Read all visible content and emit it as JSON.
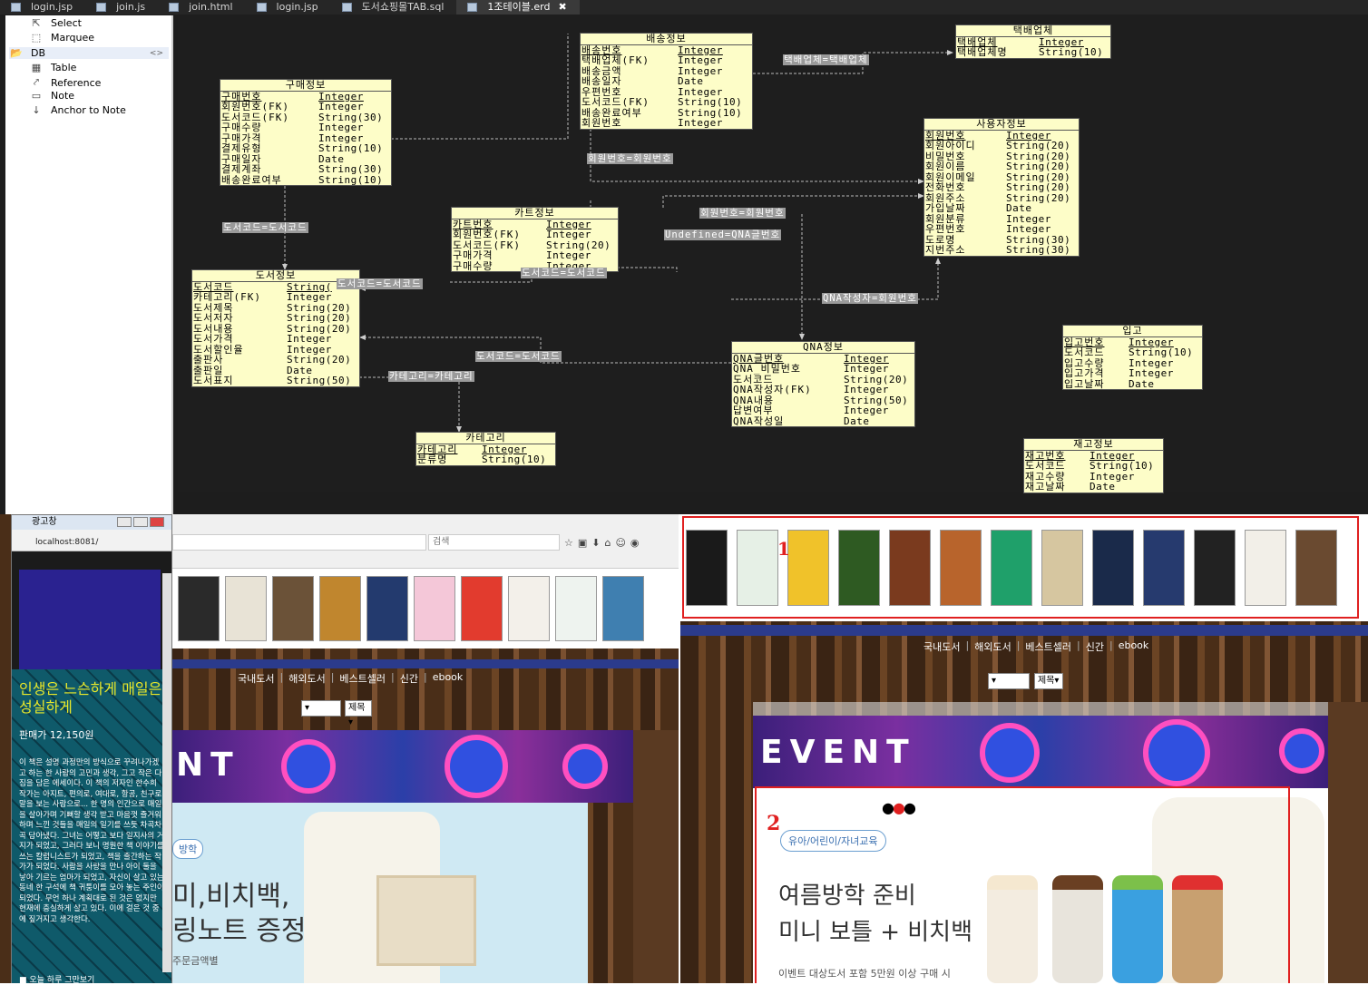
{
  "tabs": [
    {
      "label": "login.jsp"
    },
    {
      "label": "join.js"
    },
    {
      "label": "join.html"
    },
    {
      "label": "login.jsp"
    },
    {
      "label": "도서쇼핑몰TAB.sql"
    },
    {
      "label": "1조테이블.erd",
      "active": true
    }
  ],
  "palette": {
    "select": "Select",
    "marquee": "Marquee",
    "db": "DB",
    "table": "Table",
    "reference": "Reference",
    "note": "Note",
    "anchor": "Anchor to Note"
  },
  "entities": {
    "delivery_company": {
      "title": "택배업체",
      "rows": [
        [
          "택배업체",
          "Integer"
        ],
        [
          "택배업체명",
          "String(10)"
        ]
      ]
    },
    "shipping": {
      "title": "배송정보",
      "rows": [
        [
          "배송번호",
          "Integer"
        ],
        [
          "택배업체(FK)",
          "Integer"
        ],
        [
          "배송금액",
          "Integer"
        ],
        [
          "배송일자",
          "Date"
        ],
        [
          "우편번호",
          "Integer"
        ],
        [
          "도서코드(FK)",
          "String(10)"
        ],
        [
          "배송완료여부",
          "String(10)"
        ],
        [
          "회원번호",
          "Integer"
        ]
      ]
    },
    "purchase": {
      "title": "구매정보",
      "rows": [
        [
          "구매번호",
          "Integer"
        ],
        [
          "회원번호(FK)",
          "Integer"
        ],
        [
          "도서코드(FK)",
          "String(30)"
        ],
        [
          "구매수량",
          "Integer"
        ],
        [
          "구매가격",
          "Integer"
        ],
        [
          "결제유형",
          "String(10)"
        ],
        [
          "구매일자",
          "Date"
        ],
        [
          "결제계좌",
          "String(30)"
        ],
        [
          "배송완료여부",
          "String(10)"
        ]
      ]
    },
    "user": {
      "title": "사용자정보",
      "rows": [
        [
          "회원번호",
          "Integer"
        ],
        [
          "회원아이디",
          "String(20)"
        ],
        [
          "비밀번호",
          "String(20)"
        ],
        [
          "회원이름",
          "String(20)"
        ],
        [
          "회원이메일",
          "String(20)"
        ],
        [
          "전화번호",
          "String(20)"
        ],
        [
          "회원주소",
          "String(20)"
        ],
        [
          "가입날짜",
          "Date"
        ],
        [
          "회원분류",
          "Integer"
        ],
        [
          "우편번호",
          "Integer"
        ],
        [
          "도로명",
          "String(30)"
        ],
        [
          "지번주소",
          "String(30)"
        ]
      ]
    },
    "cart": {
      "title": "카트정보",
      "rows": [
        [
          "카트번호",
          "Integer"
        ],
        [
          "회원번호(FK)",
          "Integer"
        ],
        [
          "도서코드(FK)",
          "String(20)"
        ],
        [
          "구매가격",
          "Integer"
        ],
        [
          "구매수량",
          "Integer"
        ]
      ]
    },
    "book": {
      "title": "도서정보",
      "rows": [
        [
          "도서코드",
          "String("
        ],
        [
          "카테고리(FK)",
          "Integer"
        ],
        [
          "도서제목",
          "String(20)"
        ],
        [
          "도서저자",
          "String(20)"
        ],
        [
          "도서내용",
          "String(20)"
        ],
        [
          "도서가격",
          "Integer"
        ],
        [
          "도서할인율",
          "Integer"
        ],
        [
          "출판사",
          "String(20)"
        ],
        [
          "출판일",
          "Date"
        ],
        [
          "도서표지",
          "String(50)"
        ]
      ]
    },
    "qna": {
      "title": "QNA정보",
      "rows": [
        [
          "QNA글번호",
          "Integer"
        ],
        [
          "QNA_비밀번호",
          "Integer"
        ],
        [
          "도서코드",
          "String(20)"
        ],
        [
          "QNA작성자(FK)",
          "Integer"
        ],
        [
          "QNA내용",
          "String(50)"
        ],
        [
          "답변여부",
          "Integer"
        ],
        [
          "QNA작성일",
          "Date"
        ]
      ]
    },
    "inbound": {
      "title": "입고",
      "rows": [
        [
          "입고번호",
          "Integer"
        ],
        [
          "도서코드",
          "String(10)"
        ],
        [
          "입고수량",
          "Integer"
        ],
        [
          "입고가격",
          "Integer"
        ],
        [
          "입고날짜",
          "Date"
        ]
      ]
    },
    "category": {
      "title": "카테고리",
      "rows": [
        [
          "카테고리",
          "Integer"
        ],
        [
          "분류명",
          "String(10)"
        ]
      ]
    },
    "stock": {
      "title": "재고정보",
      "rows": [
        [
          "재고번호",
          "Integer"
        ],
        [
          "도서코드",
          "String(10)"
        ],
        [
          "재고수량",
          "Integer"
        ],
        [
          "재고날짜",
          "Date"
        ]
      ]
    }
  },
  "relations": {
    "r1": "택배업체=택배업체",
    "r2": "회원번호=회원번호",
    "r3": "도서코드=도서코드",
    "r4": "회원번호=회원번호",
    "r5": "Undefined=QNA글번호",
    "r6": "도서코드=도서코드",
    "r7": "도서코드=도서코드",
    "r8": "QNA작성자=회원번호",
    "r9": "도서코드=도서코드",
    "r10": "카테고리=카테고리"
  },
  "left_site": {
    "url": "localhost:8081/",
    "search_placeholder": "검색",
    "nav": [
      "국내도서",
      "해외도서",
      "베스트셀러",
      "신간",
      "ebook"
    ],
    "select_btn": "제목",
    "event_text": "NT",
    "promo_tag": "방학",
    "promo_line1": "미,비치백,",
    "promo_line2": "링노트 증정",
    "promo_small": "주문금액별"
  },
  "popup": {
    "title": "광고창",
    "address": "localhost:8081/",
    "heading": "인생은 느슨하게 매일은 성실하게",
    "price": "판매가 12,150원",
    "body": "이 책은 설명 과정만의 방식으로 꾸려나가겠고 하는 한 사람의 고민과 생각, 그고 작은 다짐을 담은 에세이다. 이 책의 저자인 한수희 작가는 아지트, 편의로, 여대로, 항공, 친구로. 말을 보는 사람으로... 한 명의 인간으로 매일을 살아가며 기뻐할 생각 받고 마음껏 즐거워하며 느낀 것들을 매일의 일기를 쓰듯 차곡차곡 담아냈다. 그녀는 어떻고 보다 일지사의 거지가 되었고, 그러다 보니 명원한 책 이야기를 쓰는 칼럼니스트가 되었고, 책을 출간하는 작가가 되었다. 사람을 사랑을 만나 아이 둘을 낳아 기르는 엄마가 되었고, 자신이 살고 있는 동네 한 구석에 책 귀퉁이를 모아 놓는 주인이 되었다. 무언 하나 계획대로 된 것은 없지만 현재에 충실하게 살고 있다. 이에 걸은 것 중에 짚거지고 생각한다.",
    "footer": "오늘 하루 그만보기"
  },
  "right_site": {
    "nav": [
      "국내도서",
      "해외도서",
      "베스트셀러",
      "신간",
      "ebook"
    ],
    "select_btn": "제목",
    "event_text": "EVENT",
    "annotation1": "1",
    "annotation2": "2",
    "promo_tag": "유아/어린이/자녀교육",
    "promo_line1": "여름방학 준비",
    "promo_line2": "미니 보틀 + 비치백",
    "promo_small": "이벤트 대상도서 포함 5만원 이상 구매 시"
  },
  "colors": {
    "entity_bg": "#fdfdc8",
    "canvas_bg": "#1e1e1e",
    "annotation_red": "#e02020",
    "event_purple": "#5a2fa0"
  }
}
